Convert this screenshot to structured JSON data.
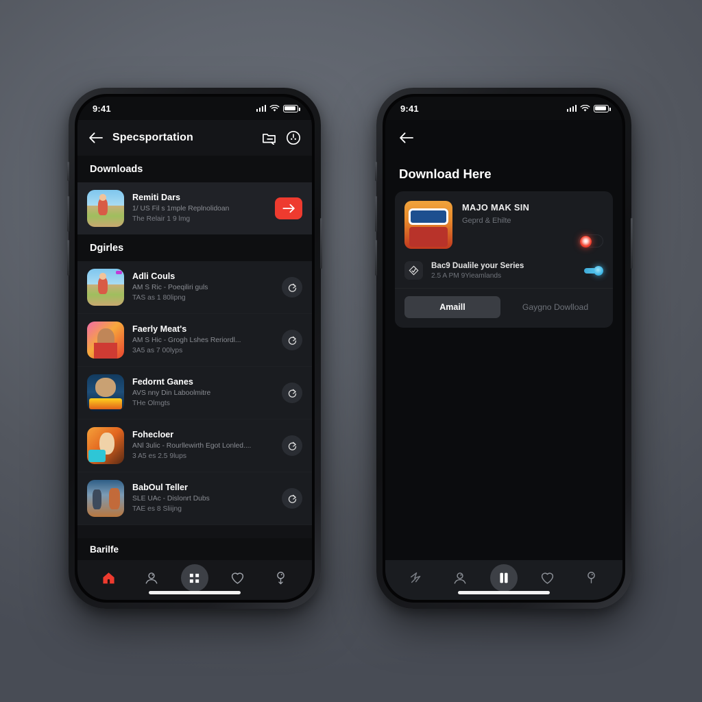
{
  "background": {
    "color_top": "#6a6f78",
    "color_bottom": "#484c55"
  },
  "accent": {
    "red": "#ee3b2f",
    "blue": "#42b9e8"
  },
  "left_phone": {
    "status_bar": {
      "time": "9:41",
      "signal_icon": "cellular-bars-icon",
      "wifi_icon": "wifi-icon",
      "battery_icon": "battery-icon"
    },
    "app_bar": {
      "back_icon": "arrow-left-icon",
      "title": "Specsportation",
      "action_1_icon": "folder-share-icon",
      "action_2_icon": "more-circle-icon"
    },
    "sections": [
      {
        "label": "Downloads"
      },
      {
        "label": "Dgirles"
      }
    ],
    "downloads": [
      {
        "title": "Remiti Dars",
        "sub1": "1/ US Fil s 1mple Replnolidoan",
        "sub2": "The Relair 1 9 lmg",
        "action_icon": "arrow-right-icon",
        "action_style": "red"
      }
    ],
    "items": [
      {
        "title": "Adli Couls",
        "sub1": "AM S Ric  -  Poeqiliri guls",
        "sub2": "TAS as 1 80lipng",
        "action_icon": "redo-icon"
      },
      {
        "title": "Faerly Meat's",
        "sub1": "AM S Hic  -  Grogh Lshes Reriordl...",
        "sub2": "3A5 as 7 00lyps",
        "action_icon": "redo-icon"
      },
      {
        "title": "Fedornt Ganes",
        "sub1": "AVS nny Din Laboolmitre",
        "sub2": "THe Olmgts",
        "action_icon": "redo-icon"
      },
      {
        "title": "Fohecloer",
        "sub1": "ANl 3ulic  -  Rourllewirth Egot Lonled....",
        "sub2": "3 A5 es 2.5 9lups",
        "action_icon": "redo-icon"
      },
      {
        "title": "BabOul Teller",
        "sub1": "SLE UAc  -  Dislonrt Dubs",
        "sub2": "TAE es 8 Sliijng",
        "action_icon": "redo-icon"
      }
    ],
    "footer_label": "Barilfe",
    "tab_bar": [
      {
        "icon": "home-icon",
        "active": true
      },
      {
        "icon": "person-search-icon",
        "active": false
      },
      {
        "icon": "library-icon",
        "active": false,
        "center": true
      },
      {
        "icon": "heart-icon",
        "active": false
      },
      {
        "icon": "profile-pin-icon",
        "active": false
      }
    ]
  },
  "right_phone": {
    "status_bar": {
      "time": "9:41",
      "signal_icon": "cellular-bars-icon",
      "wifi_icon": "wifi-icon",
      "battery_icon": "battery-icon"
    },
    "app_bar": {
      "back_icon": "arrow-left-icon"
    },
    "heading": "Download Here",
    "card": {
      "title": "MAJO MAK SIN",
      "subtitle": "Geprd & Ehilte",
      "toggle_main": {
        "state": "off",
        "color": "#f0412f"
      },
      "row2_title": "Bac9 Dualile your Series",
      "row2_sub": "2.5 A PM 9Yieamlands",
      "row2_icon": "diamond-icon",
      "toggle_row2": {
        "state": "on",
        "color": "#42b9e8"
      },
      "primary_button": "Amaill",
      "ghost_button": "Gaygno Dowlload"
    },
    "tab_bar": [
      {
        "icon": "compass-icon",
        "active": false
      },
      {
        "icon": "person-search-icon",
        "active": false
      },
      {
        "icon": "library-icon",
        "active": true,
        "center": true
      },
      {
        "icon": "heart-icon",
        "active": false
      },
      {
        "icon": "profile-pin-icon",
        "active": false
      }
    ]
  }
}
